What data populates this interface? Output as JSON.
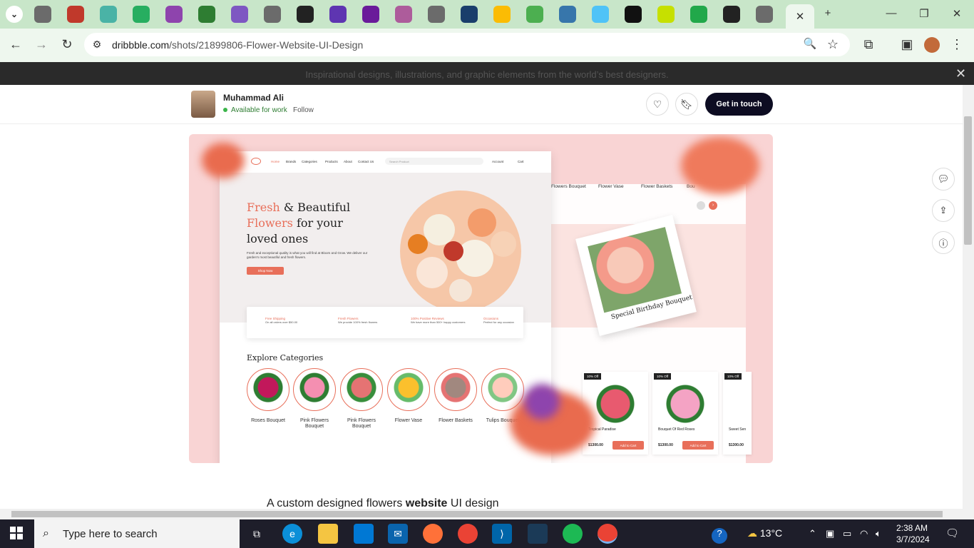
{
  "browser": {
    "url_host": "dribbble.com",
    "url_path": "/shots/21899806-Flower-Website-UI-Design",
    "tabs": [
      {
        "icon": "world-icon",
        "color": "#6b6b6b"
      },
      {
        "icon": "feather-icon",
        "color": "#c0392b"
      },
      {
        "icon": "d-app-icon",
        "color": "#4ab3a6"
      },
      {
        "icon": "leaf-icon",
        "color": "#27ae60"
      },
      {
        "icon": "u-app-icon",
        "color": "#8e44ad"
      },
      {
        "icon": "ui-icon",
        "color": "#2e7d32"
      },
      {
        "icon": "ufo-icon",
        "color": "#7e57c2"
      },
      {
        "icon": "world-icon",
        "color": "#6b6b6b"
      },
      {
        "icon": "grid-icon",
        "color": "#222"
      },
      {
        "icon": "swirl-icon",
        "color": "#5e35b1"
      },
      {
        "icon": "bolt-icon",
        "color": "#6a1b9a"
      },
      {
        "icon": "person-icon",
        "color": "#ad5c9b"
      },
      {
        "icon": "world-icon",
        "color": "#6b6b6b"
      },
      {
        "icon": "f-app-icon",
        "color": "#1a3e6b"
      },
      {
        "icon": "drive-icon",
        "color": "#fbbc04"
      },
      {
        "icon": "file-icon",
        "color": "#4caf50"
      },
      {
        "icon": "python-icon",
        "color": "#3776ab"
      },
      {
        "icon": "bird-icon",
        "color": "#4fc3f7"
      },
      {
        "icon": "square-icon",
        "color": "#111"
      },
      {
        "icon": "id-icon",
        "color": "#c6e000"
      },
      {
        "icon": "e-app-icon",
        "color": "#21a84a"
      },
      {
        "icon": "glasses-icon",
        "color": "#222"
      },
      {
        "icon": "radio-icon",
        "color": "#6b6b6b"
      }
    ]
  },
  "banner": {
    "text": "Inspirational designs, illustrations, and graphic elements from the world’s best designers."
  },
  "profile": {
    "name": "Muhammad Ali",
    "status": "Available for work",
    "follow": "Follow",
    "cta": "Get in touch"
  },
  "shot": {
    "nav": [
      "Home",
      "Brands",
      "Categories",
      "Products",
      "About",
      "Contact Us"
    ],
    "search_placeholder": "Search Product",
    "account": "Account",
    "cart": "Cart",
    "hero_line1_pink": "Fresh",
    "hero_line1_rest": " & Beautiful",
    "hero_line2_pink": "Flowers",
    "hero_line2_rest": " for your",
    "hero_line3": "loved ones",
    "hero_desc": "Fresh and exceptional quality is what you will find at Bloom and Grow. We deliver our garden's most beautiful and fresh flowers.",
    "shop_now": "Shop Now",
    "features": [
      {
        "title": "Free Shipping",
        "sub": "On all orders over $50.00"
      },
      {
        "title": "Fresh Flowers",
        "sub": "We provide 100% fresh flowers"
      },
      {
        "title": "100% Positive Reviews",
        "sub": "We have more than 500+ happy customers"
      },
      {
        "title": "Occasions",
        "sub": "Perfect for any occasion"
      }
    ],
    "explore_title": "Explore Categories",
    "categories": [
      "Roses Bouquet",
      "Pink Flowers Bouquet",
      "Pink Flowers Bouquet",
      "Flower Vase",
      "Flower Baskets",
      "Tulips Bouquet"
    ],
    "right_cats": [
      "Flowers Bouquet",
      "Flower Vase",
      "Flower Baskets",
      "Bou"
    ],
    "card_text": "Special Birthday Bouquet",
    "products": [
      {
        "tag": "10% Off",
        "name": "Tropical Paradise",
        "old": "$1400.00",
        "price": "$1300.00",
        "btn": "Add to Cart"
      },
      {
        "tag": "10% Off",
        "name": "Bouquet Of Red Roses",
        "old": "$1400.00",
        "price": "$1300.00",
        "btn": "Add to Cart"
      },
      {
        "tag": "10% Off",
        "name": "Sweet Sen",
        "old": "$1400.00",
        "price": "$1300.00",
        "btn": ""
      }
    ]
  },
  "caption": {
    "pre": "A custom designed flowers ",
    "bold": "website",
    "post": " UI design"
  },
  "taskbar": {
    "search": "Type here to search",
    "weather": "13°C",
    "time": "2:38 AM",
    "date": "3/7/2024"
  }
}
